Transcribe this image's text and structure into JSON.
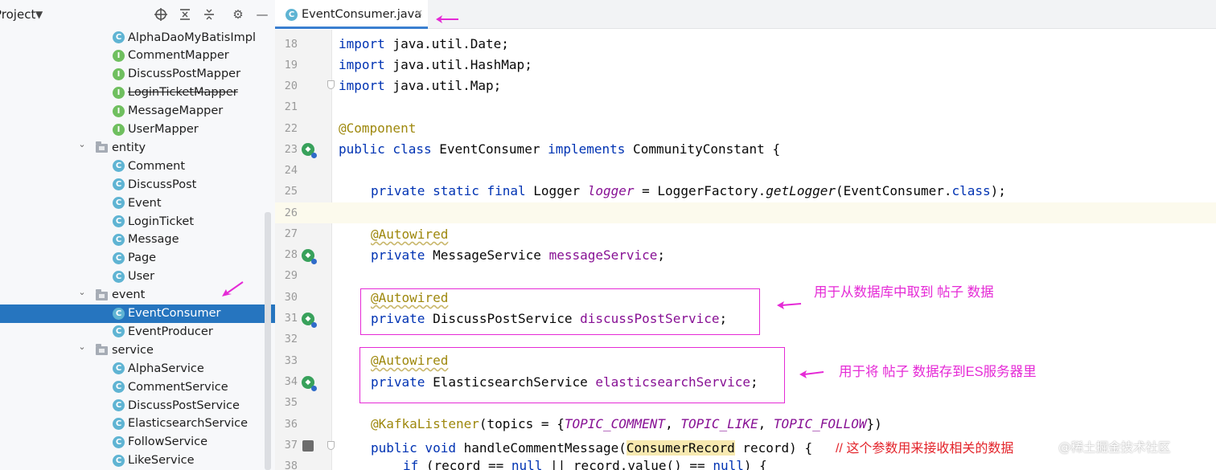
{
  "project_panel": {
    "title": "Project",
    "header_icons": [
      "target-icon",
      "expand-all-icon",
      "collapse-all-icon",
      "gear-icon",
      "minimize-icon"
    ],
    "items": [
      {
        "label": "AlphaDaoMyBatisImpl",
        "kind": "class",
        "badge": "C"
      },
      {
        "label": "CommentMapper",
        "kind": "interface",
        "badge": "I"
      },
      {
        "label": "DiscussPostMapper",
        "kind": "interface",
        "badge": "I"
      },
      {
        "label": "LoginTicketMapper",
        "kind": "interface",
        "badge": "I",
        "deprecated": true
      },
      {
        "label": "MessageMapper",
        "kind": "interface",
        "badge": "I"
      },
      {
        "label": "UserMapper",
        "kind": "interface",
        "badge": "I"
      },
      {
        "label": "entity",
        "kind": "package"
      },
      {
        "label": "Comment",
        "kind": "class",
        "badge": "C"
      },
      {
        "label": "DiscussPost",
        "kind": "class",
        "badge": "C"
      },
      {
        "label": "Event",
        "kind": "class",
        "badge": "C"
      },
      {
        "label": "LoginTicket",
        "kind": "class",
        "badge": "C"
      },
      {
        "label": "Message",
        "kind": "class",
        "badge": "C"
      },
      {
        "label": "Page",
        "kind": "class",
        "badge": "C"
      },
      {
        "label": "User",
        "kind": "class",
        "badge": "C"
      },
      {
        "label": "event",
        "kind": "package"
      },
      {
        "label": "EventConsumer",
        "kind": "class",
        "badge": "C",
        "selected": true
      },
      {
        "label": "EventProducer",
        "kind": "class",
        "badge": "C"
      },
      {
        "label": "service",
        "kind": "package"
      },
      {
        "label": "AlphaService",
        "kind": "class",
        "badge": "C"
      },
      {
        "label": "CommentService",
        "kind": "class",
        "badge": "C"
      },
      {
        "label": "DiscussPostService",
        "kind": "class",
        "badge": "C"
      },
      {
        "label": "ElasticsearchService",
        "kind": "class",
        "badge": "C"
      },
      {
        "label": "FollowService",
        "kind": "class",
        "badge": "C"
      },
      {
        "label": "LikeService",
        "kind": "class",
        "badge": "C"
      }
    ]
  },
  "editor": {
    "tab": {
      "label": "EventConsumer.java",
      "badge": "C",
      "close": "×"
    },
    "line_numbers": [
      "18",
      "19",
      "20",
      "21",
      "22",
      "23",
      "24",
      "25",
      "26",
      "27",
      "28",
      "29",
      "30",
      "31",
      "32",
      "33",
      "34",
      "35",
      "36",
      "37",
      "38"
    ],
    "code": {
      "l18": {
        "kw": "import",
        "rest": " java.util.Date;"
      },
      "l19": {
        "kw": "import",
        "rest": " java.util.HashMap;"
      },
      "l20": {
        "kw": "import",
        "rest": " java.util.Map;"
      },
      "l22": {
        "ann": "@Component"
      },
      "l23": {
        "kw1": "public class",
        "name": " EventConsumer ",
        "kw2": "implements",
        "rest": " CommunityConstant {"
      },
      "l25": {
        "kw": "private static final",
        "t1": " Logger ",
        "field": "logger",
        "t2": " = LoggerFactory.",
        "call": "getLogger",
        "t3": "(EventConsumer.",
        "kw2": "class",
        "t4": ");"
      },
      "l27": {
        "ann": "@Autowired"
      },
      "l28": {
        "kw": "private",
        "type": " MessageService ",
        "field": "messageService",
        "end": ";"
      },
      "l30": {
        "ann": "@Autowired"
      },
      "l31": {
        "kw": "private",
        "type": " DiscussPostService ",
        "field": "discussPostService",
        "end": ";"
      },
      "l33": {
        "ann": "@Autowired"
      },
      "l34": {
        "kw": "private",
        "type": " ElasticsearchService ",
        "field": "elasticsearchService",
        "end": ";"
      },
      "l36": {
        "ann": "@KafkaListener",
        "t1": "(topics = {",
        "c1": "TOPIC_COMMENT",
        "sep1": ", ",
        "c2": "TOPIC_LIKE",
        "sep2": ", ",
        "c3": "TOPIC_FOLLOW",
        "t2": "})"
      },
      "l37": {
        "kw": "public void",
        "t1": " handleCommentMessage(",
        "param_type": "ConsumerRecord",
        "t2": " record) {",
        "comment": "// 这个参数用来接收相关的数据"
      },
      "l38": {
        "kw1": "if",
        "t1": " (record == ",
        "kw2": "null",
        "t2": " || record.value() == ",
        "kw3": "null",
        "t3": ") {"
      }
    }
  },
  "annotations": {
    "note1": "用于从数据库中取到 帖子 数据",
    "note2": "用于将 帖子 数据存到ES服务器里",
    "color": "#e52ad6"
  },
  "watermark": "@稀土掘金技术社区"
}
